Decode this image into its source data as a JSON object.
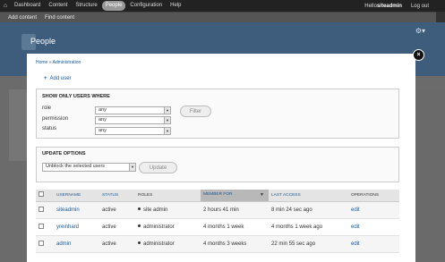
{
  "toolbar": {
    "items": [
      "Dashboard",
      "Content",
      "Structure",
      "People",
      "Configuration",
      "Help"
    ],
    "active_index": 3,
    "greeting": "Hello ",
    "username": "siteadmin",
    "logout": "Log out"
  },
  "shortcuts": [
    "Add content",
    "Find content"
  ],
  "page": {
    "title": "People"
  },
  "breadcrumb": "Home » Administration",
  "add_user": "Add user",
  "filter": {
    "legend": "Show only users where",
    "fields": [
      {
        "label": "role",
        "value": "any"
      },
      {
        "label": "permission",
        "value": "any"
      },
      {
        "label": "status",
        "value": "any"
      }
    ],
    "button": "Filter"
  },
  "update": {
    "legend": "Update options",
    "selected": "Unblock the selected users",
    "button": "Update"
  },
  "table": {
    "headers": [
      "Username",
      "Status",
      "Roles",
      "Member for",
      "Last access",
      "Operations"
    ],
    "rows": [
      {
        "username": "siteadmin",
        "status": "active",
        "roles": "site admin",
        "member_for": "2 hours 41 min",
        "last_access": "8 min 24 sec ago",
        "operation": "edit"
      },
      {
        "username": "yreinhard",
        "status": "active",
        "roles": "administrator",
        "member_for": "4 months 1 week",
        "last_access": "4 months 1 week ago",
        "operation": "edit"
      },
      {
        "username": "admin",
        "status": "active",
        "roles": "administrator",
        "member_for": "4 months 3 weeks",
        "last_access": "22 min 55 sec ago",
        "operation": "edit"
      }
    ]
  },
  "colors": {
    "toolbar": "#222222",
    "link": "#1a5a96",
    "header_bg": "#3e5d7d",
    "overlay_bg": "#ffffff"
  }
}
